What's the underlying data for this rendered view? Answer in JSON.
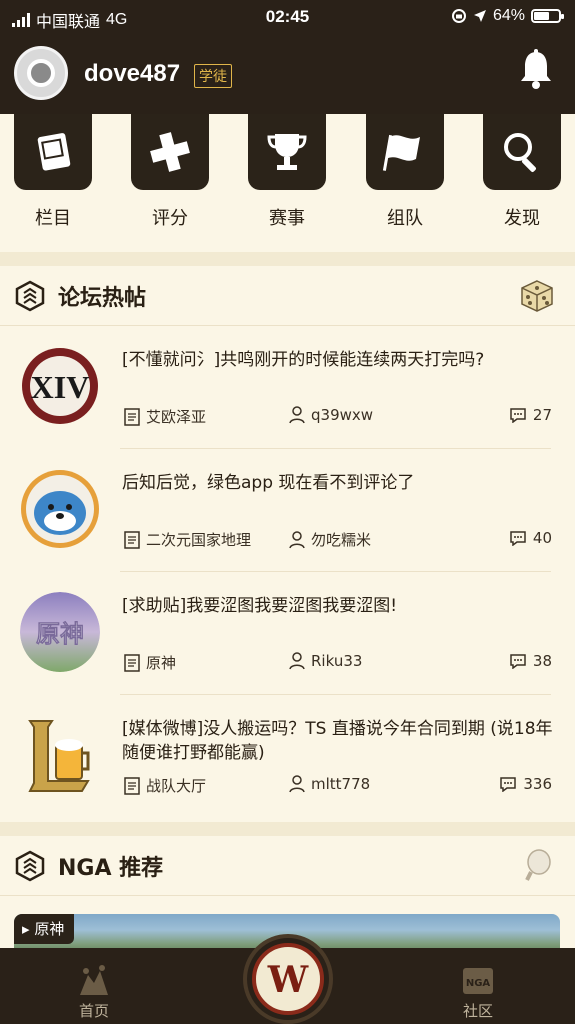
{
  "status_bar": {
    "carrier": "中国联通",
    "network": "4G",
    "time": "02:45",
    "battery": "64%",
    "battery_level": 0.64
  },
  "header": {
    "username": "dove487",
    "badge": "学徒"
  },
  "categories": [
    {
      "label": "栏目",
      "icon": "book-icon"
    },
    {
      "label": "评分",
      "icon": "gamepad-icon"
    },
    {
      "label": "赛事",
      "icon": "trophy-icon"
    },
    {
      "label": "组队",
      "icon": "flag-icon"
    },
    {
      "label": "发现",
      "icon": "magnifier-icon"
    }
  ],
  "forum_hot": {
    "title": "论坛热帖",
    "posts": [
      {
        "title": "[不懂就问氵]共鸣刚开的时候能连续两天打完吗?",
        "board": "艾欧泽亚",
        "author": "q39wxw",
        "replies": "27",
        "avatar": "ffxiv-logo"
      },
      {
        "title": "后知后觉，绿色app 现在看不到评论了",
        "board": "二次元国家地理",
        "author": "勿吃糯米",
        "replies": "40",
        "avatar": "blue-cat-avatar"
      },
      {
        "title": "[求助贴]我要涩图我要涩图我要涩图!",
        "board": "原神",
        "author": "Riku33",
        "replies": "38",
        "avatar": "genshin-logo"
      },
      {
        "title": "[媒体微博]没人搬运吗？TS 直播说今年合同到期 (说18年随便谁打野都能赢)",
        "board": "战队大厅",
        "author": "mltt778",
        "replies": "336",
        "avatar": "lol-beer-logo"
      }
    ]
  },
  "nga_recommend": {
    "title": "NGA 推荐",
    "banner_tag": "原神"
  },
  "tabbar": {
    "home": "首页",
    "community": "社区",
    "center_letter": "W",
    "community_icon_text": "NGA"
  }
}
